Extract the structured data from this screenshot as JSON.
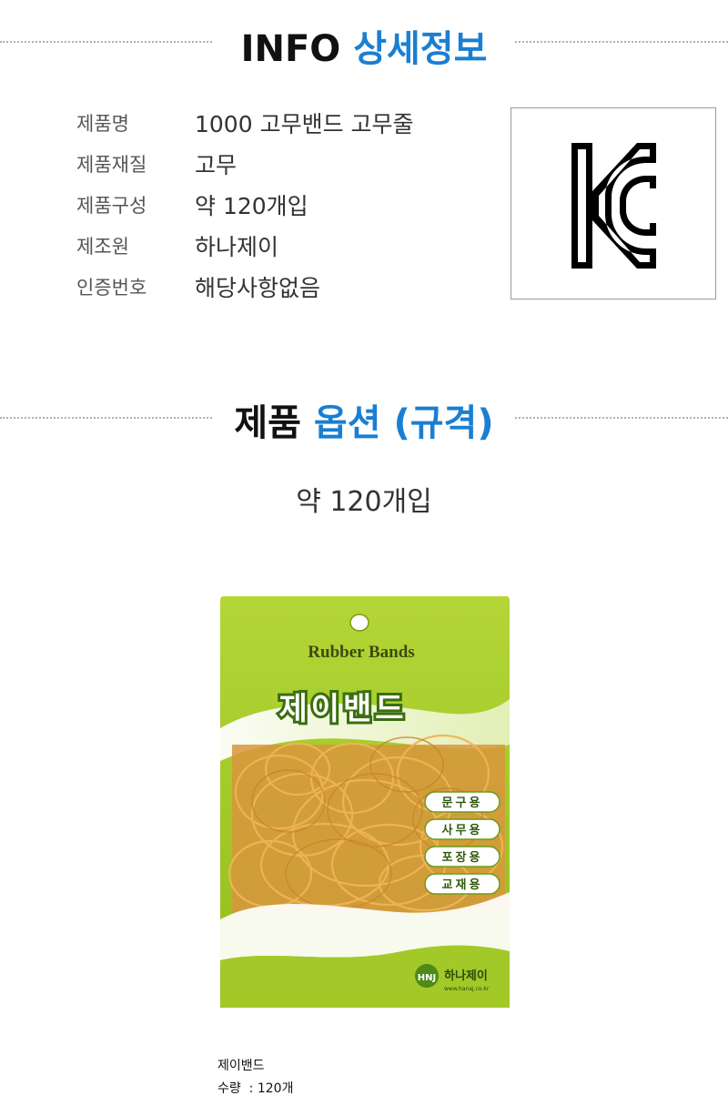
{
  "info_header": {
    "latin": "INFO",
    "korean": "상세정보"
  },
  "info_rows": [
    {
      "label": "제품명",
      "value": "1000 고무밴드 고무줄"
    },
    {
      "label": "제품재질",
      "value": "고무"
    },
    {
      "label": "제품구성",
      "value": "약 120개입"
    },
    {
      "label": "제조원",
      "value": "하나제이"
    },
    {
      "label": "인증번호",
      "value": "해당사항없음"
    }
  ],
  "certification_mark": "KC",
  "option_header": {
    "dark": "제품",
    "accent": "옵션 (규격)"
  },
  "option_value": "약 120개입",
  "package": {
    "english_title": "Rubber Bands",
    "brand_title": "제이밴드",
    "uses": [
      "문구용",
      "사무용",
      "포장용",
      "교재용"
    ],
    "maker_logo": "HNJ",
    "maker_name": "하나제이",
    "maker_url": "www.hanaj.co.kr",
    "colors": {
      "bag_green": "#a6cc2a",
      "band_orange": "#e0a44a",
      "accent_blue": "#1a7fd1"
    }
  },
  "caption": {
    "name": "제이밴드",
    "qty_label": "수량",
    "qty_value": "120개"
  }
}
